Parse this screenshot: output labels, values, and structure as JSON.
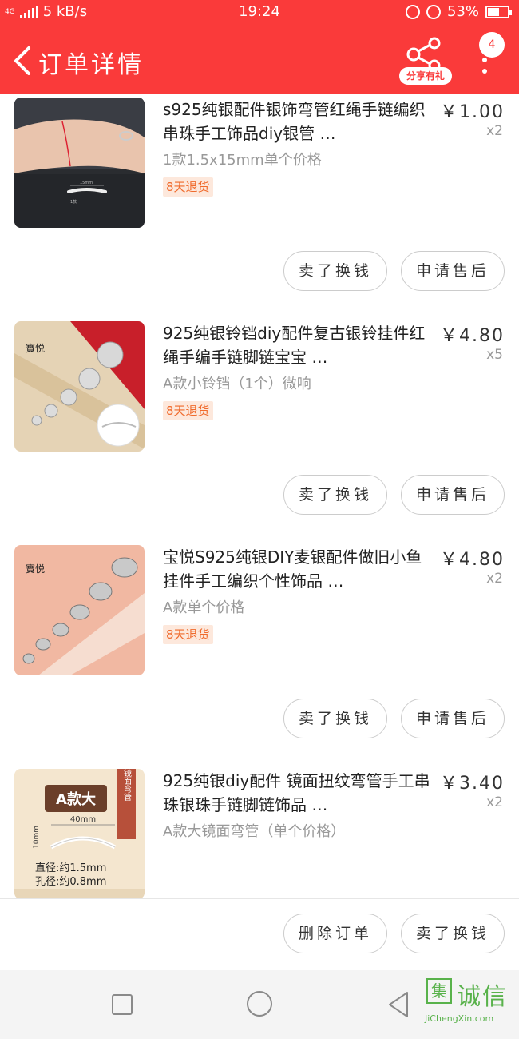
{
  "status_bar": {
    "network": "4G",
    "speed": "5 kB/s",
    "time": "19:24",
    "battery": "53%",
    "battery_level": 0.53
  },
  "header": {
    "title": "订单详情",
    "share_label": "分享有礼",
    "notification_count": "4"
  },
  "items": [
    {
      "title": "s925纯银配件银饰弯管红绳手链编织串珠手工饰品diy银管 …",
      "price": "￥1.00",
      "qty": "x2",
      "spec": "1款1.5x15mm单个价格",
      "tag": "8天退货",
      "buttons": [
        "卖了换钱",
        "申请售后"
      ]
    },
    {
      "title": "925纯银铃铛diy配件复古银铃挂件红绳手编手链脚链宝宝 …",
      "price": "￥4.80",
      "qty": "x5",
      "spec": "A款小铃铛（1个）微响",
      "tag": "8天退货",
      "buttons": [
        "卖了换钱",
        "申请售后"
      ]
    },
    {
      "title": "宝悦S925纯银DIY麦银配件做旧小鱼挂件手工编织个性饰品 …",
      "price": "￥4.80",
      "qty": "x2",
      "spec": "A款单个价格",
      "tag": "8天退货",
      "buttons": [
        "卖了换钱",
        "申请售后"
      ]
    },
    {
      "title": "925纯银diy配件 镜面扭纹弯管手工串珠银珠手链脚链饰品 …",
      "price": "￥3.40",
      "qty": "x2",
      "spec": "A款大镜面弯管（单个价格）",
      "tag": "",
      "buttons": []
    }
  ],
  "thumbs": {
    "item1_label": "1款",
    "item1_dim": "15mm",
    "item2_brand": "寶悦",
    "item3_brand": "寶悦",
    "item4": {
      "badge": "A款大",
      "side": "镜面弯管",
      "width": "40mm",
      "height": "10mm",
      "diameter": "直径:约1.5mm",
      "hole": "孔径:约0.8mm"
    }
  },
  "action_bar": {
    "delete_label": "删除订单",
    "sell_label": "卖了换钱"
  },
  "watermark": {
    "box": "集",
    "text": "诚信",
    "url": "JiChengXin.com"
  },
  "colors": {
    "brand_red": "#fa3a3a",
    "tag_orange": "#f06b2d",
    "watermark_green": "#59b24b"
  }
}
